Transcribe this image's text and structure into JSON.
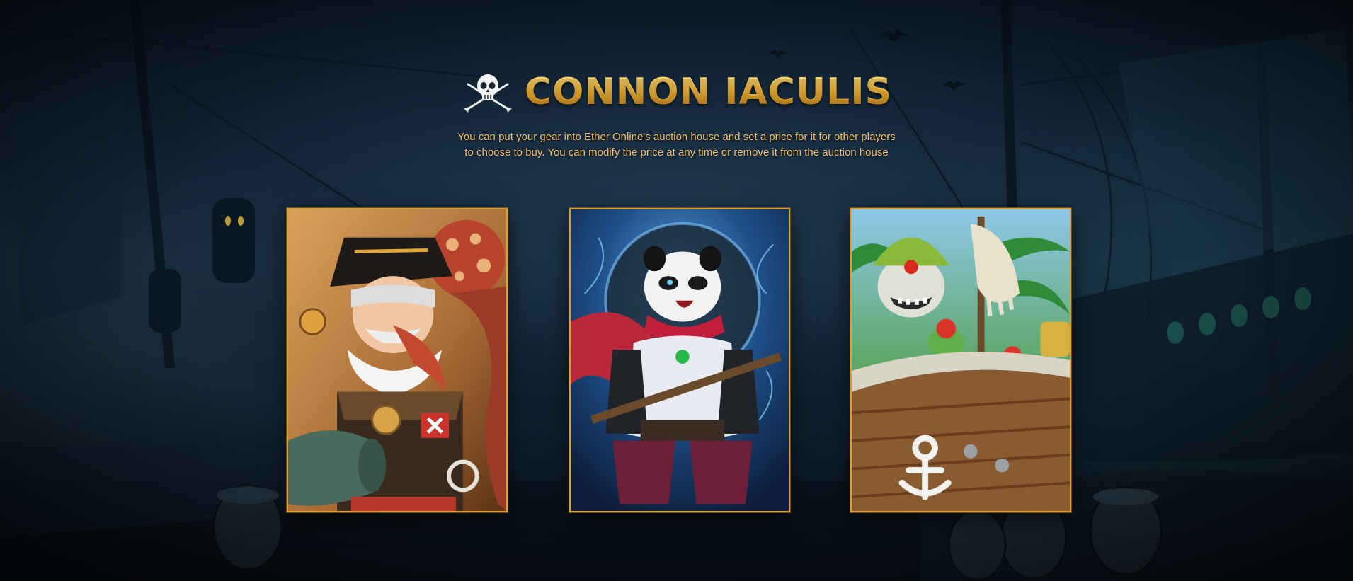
{
  "header": {
    "title": "CONNON IACULIS",
    "logo_icon": "skull-crossed-swords-icon"
  },
  "description": {
    "line1": "You can put your gear into Ether Online's auction house and set a price for it for other players",
    "line2": "to choose to buy. You can modify the price at any time or remove it from the auction house"
  },
  "cards": [
    {
      "icon": "pirate-captain-portrait"
    },
    {
      "icon": "panda-warrior-portrait"
    },
    {
      "icon": "pirate-ship-crew-portrait"
    }
  ],
  "colors": {
    "accent_gold": "#f4b637",
    "text_gold": "#f2c070",
    "frame_gold": "#d9a03a",
    "background": "#0f1d2c"
  }
}
